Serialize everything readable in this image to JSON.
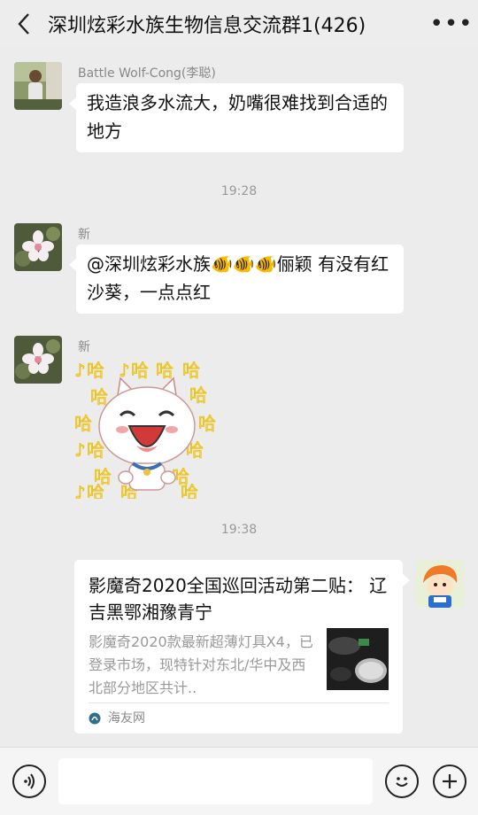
{
  "header": {
    "title": "深圳炫彩水族生物信息交流群1(426)",
    "back_icon": "chevron-left-icon",
    "more_icon": "more-dots-icon",
    "more_label": "•••"
  },
  "messages": [
    {
      "sender": "Battle Wolf-Cong(李聪)",
      "text": "我造浪多水流大，奶嘴很难找到合适的地方",
      "avatar": "person-photo-avatar"
    },
    {
      "timestamp": "19:28"
    },
    {
      "sender": "新",
      "text": "@深圳炫彩水族🐠🐠🐠俪颖  有没有红沙葵，一点点红",
      "avatar": "flower-photo-avatar"
    },
    {
      "sender": "新",
      "sticker": "laughing-cat-sticker",
      "sticker_text": "哈",
      "avatar": "flower-photo-avatar"
    },
    {
      "timestamp": "19:38"
    },
    {
      "card_title": "影魔奇2020全国巡回活动第二贴： 辽吉黑鄂湘豫青宁",
      "card_desc": "影魔奇2020款最新超薄灯具X4，已登录市场，现特针对东北/华中及西北部分地区共计..",
      "card_source": "海友网",
      "avatar": "cartoon-avatar"
    }
  ],
  "bottom_bar": {
    "voice_icon": "voice-icon",
    "emoji_icon": "emoji-icon",
    "plus_icon": "plus-icon",
    "input_value": ""
  }
}
